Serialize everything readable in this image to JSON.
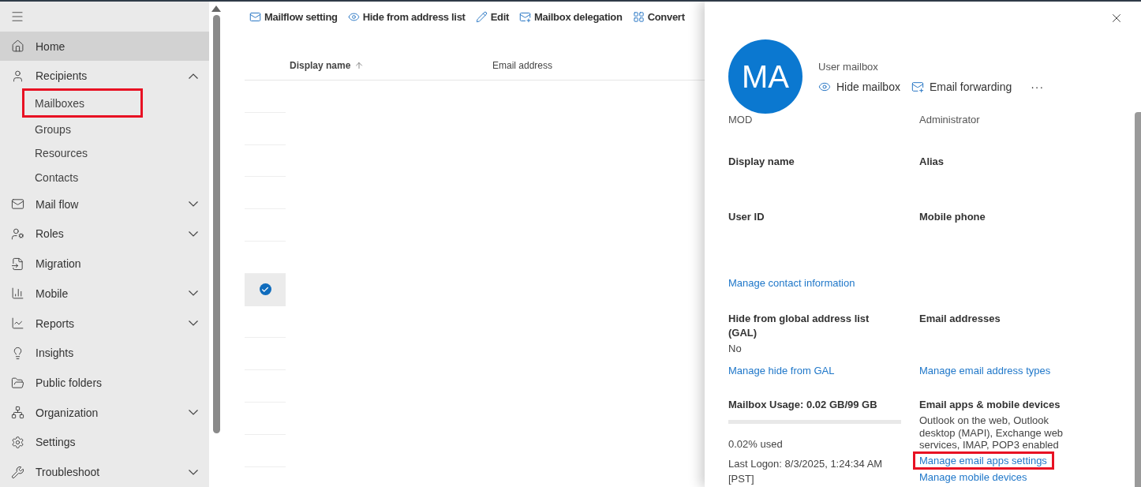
{
  "sidebar": {
    "items": [
      {
        "label": "Home",
        "kind": "link",
        "selected": true
      },
      {
        "label": "Recipients",
        "kind": "group",
        "expanded": true,
        "selected": false,
        "children": [
          {
            "label": "Mailboxes",
            "highlighted": true
          },
          {
            "label": "Groups",
            "highlighted": false
          },
          {
            "label": "Resources",
            "highlighted": false
          },
          {
            "label": "Contacts",
            "highlighted": false
          }
        ]
      },
      {
        "label": "Mail flow",
        "kind": "group",
        "expanded": false,
        "selected": false
      },
      {
        "label": "Roles",
        "kind": "group",
        "expanded": false,
        "selected": false
      },
      {
        "label": "Migration",
        "kind": "link",
        "selected": false
      },
      {
        "label": "Mobile",
        "kind": "group",
        "expanded": false,
        "selected": false
      },
      {
        "label": "Reports",
        "kind": "group",
        "expanded": false,
        "selected": false
      },
      {
        "label": "Insights",
        "kind": "link",
        "selected": false
      },
      {
        "label": "Public folders",
        "kind": "link",
        "selected": false
      },
      {
        "label": "Organization",
        "kind": "group",
        "expanded": false,
        "selected": false
      },
      {
        "label": "Settings",
        "kind": "link",
        "selected": false
      },
      {
        "label": "Troubleshoot",
        "kind": "group",
        "expanded": false,
        "selected": false
      }
    ]
  },
  "toolbar": [
    "Mailflow setting",
    "Hide from address list",
    "Edit",
    "Mailbox delegation",
    "Convert"
  ],
  "table": {
    "columns": [
      {
        "label": "Display name",
        "sorted": true
      },
      {
        "label": "Email address",
        "sorted": false
      }
    ],
    "rows": [
      {
        "selected": false
      },
      {
        "selected": false
      },
      {
        "selected": false
      },
      {
        "selected": false
      },
      {
        "selected": false
      },
      {
        "selected": false
      },
      {
        "selected": true
      },
      {
        "selected": false
      },
      {
        "selected": false
      },
      {
        "selected": false
      },
      {
        "selected": false
      },
      {
        "selected": false
      }
    ]
  },
  "panel": {
    "initials": "MA",
    "type": "User mailbox",
    "actions": [
      "Hide mailbox",
      "Email forwarding"
    ],
    "more": "···",
    "cut_values": [
      "MOD",
      "Administrator"
    ],
    "properties": [
      "Display name",
      "Alias",
      "User ID",
      "Mobile phone"
    ],
    "contact_link": "Manage contact information",
    "sections": [
      {
        "label": "Hide from global address list (GAL)",
        "value": "No",
        "links": [
          {
            "text": "Manage hide from GAL",
            "highlighted": false
          }
        ]
      },
      {
        "label": "Email addresses",
        "links": [
          {
            "text": "Manage email address types",
            "highlighted": false
          }
        ]
      },
      {
        "label": "Mailbox Usage: 0.02 GB/99 GB",
        "usage": {
          "level": 0.0002,
          "used": "0.02% used",
          "last_logon": "Last Logon: 8/3/2025, 1:24:34 AM [PST]"
        }
      },
      {
        "label": "Email apps & mobile devices",
        "value": "Outlook on the web, Outlook desktop (MAPI), Exchange web services, IMAP, POP3 enabled",
        "links": [
          {
            "text": "Manage email apps settings",
            "highlighted": true
          },
          {
            "text": "Manage mobile devices",
            "highlighted": false
          }
        ]
      }
    ]
  }
}
